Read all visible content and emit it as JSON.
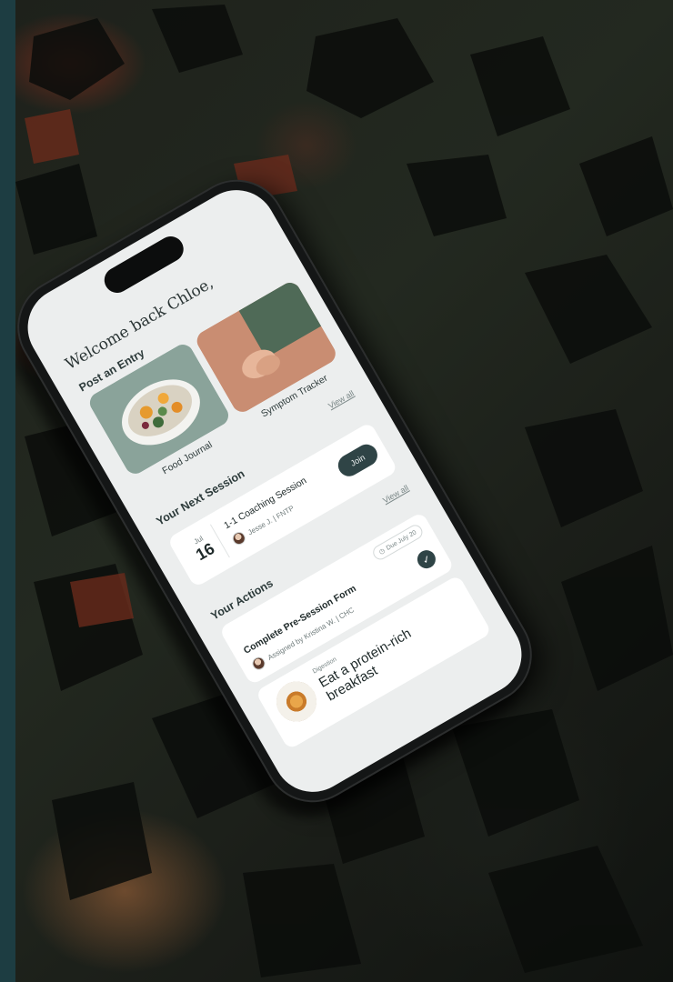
{
  "app": {
    "welcome": "Welcome back Chloe,",
    "post_entry": {
      "title": "Post an Entry",
      "cards": [
        {
          "label": "Food Journal",
          "icon": "salad-bowl-photo"
        },
        {
          "label": "Symptom Tracker",
          "icon": "stomach-hands-photo"
        }
      ],
      "view_all": "View all"
    },
    "next_session": {
      "title": "Your Next Session",
      "month": "Jul",
      "day": "16",
      "session_title": "1-1 Coaching Session",
      "coach": "Jesse J. | FNTP",
      "join_label": "Join",
      "view_all": "View all"
    },
    "actions": {
      "title": "Your Actions",
      "form": {
        "title": "Complete Pre-Session Form",
        "assignee": "Assigned by Kristina W. | CHC",
        "due": "Due July 20"
      },
      "task": {
        "category": "Digestion",
        "title": "Eat a protein-rich breakfast"
      }
    }
  },
  "colors": {
    "screen_bg": "#eceeee",
    "accent": "#2f4446",
    "card_bg": "#ffffff"
  }
}
